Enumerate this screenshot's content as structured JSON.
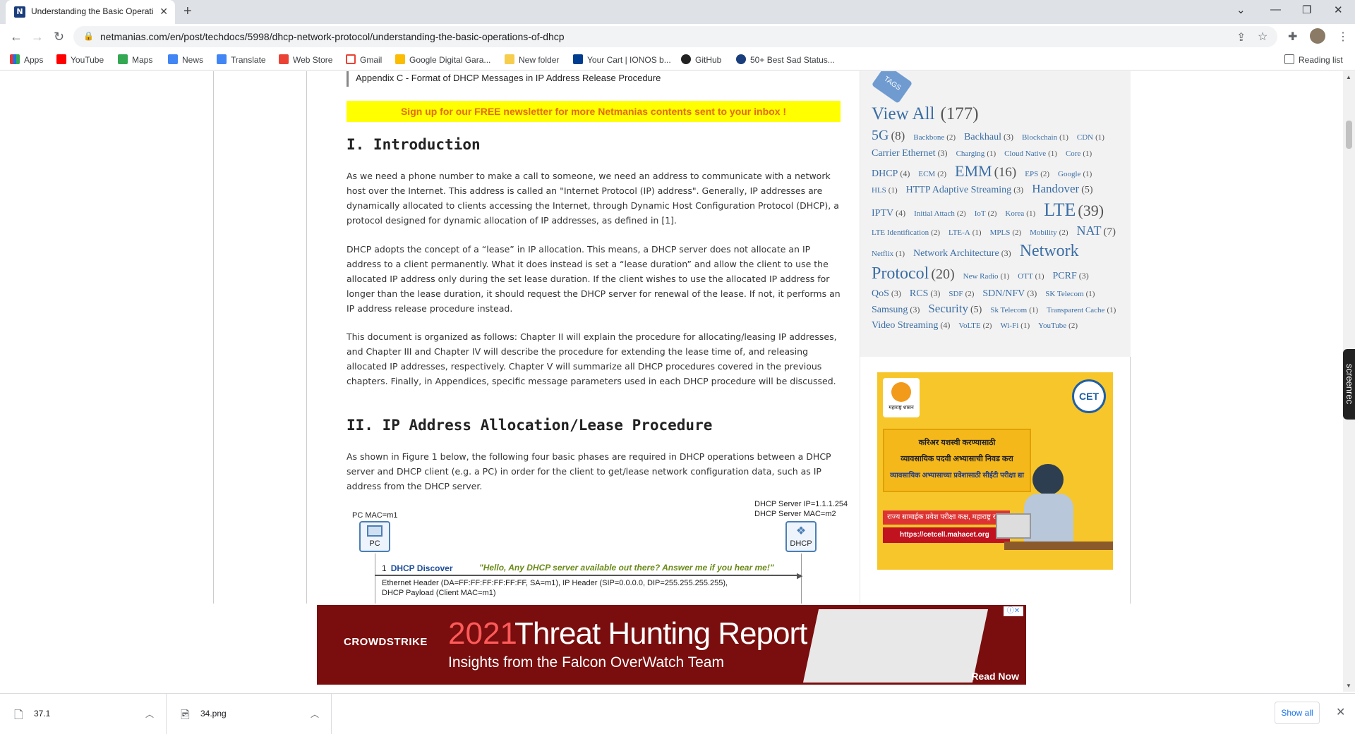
{
  "browser": {
    "tab_title": "Understanding the Basic Operati",
    "url": "netmanias.com/en/post/techdocs/5998/dhcp-network-protocol/understanding-the-basic-operations-of-dhcp",
    "bookmarks": [
      "Apps",
      "YouTube",
      "Maps",
      "News",
      "Translate",
      "Web Store",
      "Gmail",
      "Google Digital Gara...",
      "New folder",
      "Your Cart | IONOS b...",
      "GitHub",
      "50+ Best Sad Status..."
    ],
    "reading_list": "Reading list"
  },
  "article": {
    "appendix": "Appendix C - Format of DHCP Messages in IP Address Release Procedure",
    "newsletter": "Sign up for our FREE newsletter for more Netmanias contents sent to your inbox !",
    "h_intro": "I. Introduction",
    "p1": "As we need a phone number to make a call to someone, we need an address to communicate with a network host over the Internet. This address is called an \"Internet Protocol (IP) address\". Generally, IP addresses are dynamically allocated to clients accessing the Internet, through Dynamic Host Configuration Protocol (DHCP), a protocol designed for dynamic allocation of IP addresses, as defined in [1].",
    "p2": "DHCP adopts the concept of a “lease” in IP allocation. This means, a DHCP server does not allocate an IP address to a client permanently. What it does instead is set a “lease duration” and allow the client to use the allocated IP address only during the set lease duration. If the client wishes to use the allocated IP address for longer than the lease duration, it should request the DHCP server for renewal of the lease. If not, it performs an IP address release procedure instead.",
    "p3": "This document is organized as follows: Chapter II will explain the procedure for allocating/leasing IP addresses, and Chapter III and Chapter IV will describe the procedure for extending the lease time of, and releasing allocated IP addresses, respectively. Chapter V will summarize all DHCP procedures covered in the previous chapters. Finally, in Appendices, specific message parameters used in each DHCP procedure will be discussed.",
    "h_alloc": "II. IP Address Allocation/Lease Procedure",
    "p4": "As shown in Figure 1 below, the following four basic phases are required in DHCP operations between a DHCP server and DHCP client (e.g. a PC) in order for the client to get/lease network configuration data, such as IP address from the DHCP server."
  },
  "figure": {
    "pc_mac": "PC MAC=m1",
    "pc_label": "PC",
    "server_ip": "DHCP Server IP=1.1.1.254",
    "server_mac": "DHCP Server MAC=m2",
    "server_label": "DHCP",
    "step_num": "1",
    "step_name": "DHCP Discover",
    "quote": "\"Hello, Any DHCP server available out there? Answer me if you hear me!\"",
    "eth_header": "Ethernet Header (DA=FF:FF:FF:FF:FF:FF, SA=m1), IP Header (SIP=0.0.0.0, DIP=255.255.255.255),",
    "payload": "DHCP Payload (Client MAC=m1)"
  },
  "sidebar": {
    "tag_label": "TAGS",
    "view_all": "View All",
    "view_all_count": "(177)",
    "tags": [
      {
        "t": "5G",
        "c": "(8)",
        "s": 20
      },
      {
        "t": "Backbone",
        "c": "(2)",
        "s": 11
      },
      {
        "t": "Backhaul",
        "c": "(3)",
        "s": 14
      },
      {
        "t": "Blockchain",
        "c": "(1)",
        "s": 11
      },
      {
        "t": "CDN",
        "c": "(1)",
        "s": 11
      },
      {
        "t": "Carrier Ethernet",
        "c": "(3)",
        "s": 14
      },
      {
        "t": "Charging",
        "c": "(1)",
        "s": 11
      },
      {
        "t": "Cloud Native",
        "c": "(1)",
        "s": 11
      },
      {
        "t": "Core",
        "c": "(1)",
        "s": 11
      },
      {
        "t": "DHCP",
        "c": "(4)",
        "s": 14
      },
      {
        "t": "ECM",
        "c": "(2)",
        "s": 11
      },
      {
        "t": "EMM",
        "c": "(16)",
        "s": 22
      },
      {
        "t": "EPS",
        "c": "(2)",
        "s": 11
      },
      {
        "t": "Google",
        "c": "(1)",
        "s": 11
      },
      {
        "t": "HLS",
        "c": "(1)",
        "s": 11
      },
      {
        "t": "HTTP Adaptive Streaming",
        "c": "(3)",
        "s": 14
      },
      {
        "t": "Handover",
        "c": "(5)",
        "s": 17
      },
      {
        "t": "IPTV",
        "c": "(4)",
        "s": 14
      },
      {
        "t": "Initial Attach",
        "c": "(2)",
        "s": 11
      },
      {
        "t": "IoT",
        "c": "(2)",
        "s": 11
      },
      {
        "t": "Korea",
        "c": "(1)",
        "s": 11
      },
      {
        "t": "LTE",
        "c": "(39)",
        "s": 26
      },
      {
        "t": "LTE Identification",
        "c": "(2)",
        "s": 11
      },
      {
        "t": "LTE-A",
        "c": "(1)",
        "s": 11
      },
      {
        "t": "MPLS",
        "c": "(2)",
        "s": 11
      },
      {
        "t": "Mobility",
        "c": "(2)",
        "s": 11
      },
      {
        "t": "NAT",
        "c": "(7)",
        "s": 18
      },
      {
        "t": "Netflix",
        "c": "(1)",
        "s": 11
      },
      {
        "t": "Network Architecture",
        "c": "(3)",
        "s": 14
      },
      {
        "t": "Network Protocol",
        "c": "(20)",
        "s": 24
      },
      {
        "t": "New Radio",
        "c": "(1)",
        "s": 11
      },
      {
        "t": "OTT",
        "c": "(1)",
        "s": 11
      },
      {
        "t": "PCRF",
        "c": "(3)",
        "s": 14
      },
      {
        "t": "QoS",
        "c": "(3)",
        "s": 14
      },
      {
        "t": "RCS",
        "c": "(3)",
        "s": 14
      },
      {
        "t": "SDF",
        "c": "(2)",
        "s": 11
      },
      {
        "t": "SDN/NFV",
        "c": "(3)",
        "s": 14
      },
      {
        "t": "SK Telecom",
        "c": "(1)",
        "s": 11
      },
      {
        "t": "Samsung",
        "c": "(3)",
        "s": 14
      },
      {
        "t": "Security",
        "c": "(5)",
        "s": 17
      },
      {
        "t": "Sk Telecom",
        "c": "(1)",
        "s": 11
      },
      {
        "t": "Transparent Cache",
        "c": "(1)",
        "s": 11
      },
      {
        "t": "Video Streaming",
        "c": "(4)",
        "s": 14
      },
      {
        "t": "VoLTE",
        "c": "(2)",
        "s": 11
      },
      {
        "t": "Wi-Fi",
        "c": "(1)",
        "s": 11
      },
      {
        "t": "YouTube",
        "c": "(2)",
        "s": 11
      }
    ]
  },
  "ad_side": {
    "gov_label": "महाराष्ट्र शासन",
    "cet": "CET",
    "line1": "करिअर यशस्वी करण्यासाठी",
    "line2": "व्यावसायिक पदवी अभ्यासाची निवड करा",
    "line3": "व्यावसायिक अभ्यासाच्या प्रवेशासाठी सीईटी परीक्षा द्या",
    "cell": "राज्य सामाईक प्रवेश परीक्षा कक्ष, महाराष्ट्र राज्य",
    "url": "https://cetcell.mahacet.org"
  },
  "ad_bottom": {
    "brand": "CROWDSTRIKE",
    "year": "2021",
    "headline": "Threat Hunting Report",
    "sub": "Insights from the Falcon OverWatch Team",
    "cta": "Read Now"
  },
  "downloads": {
    "items": [
      "37.1",
      "34.png"
    ],
    "show_all": "Show all"
  },
  "screenrec": "screenrec"
}
